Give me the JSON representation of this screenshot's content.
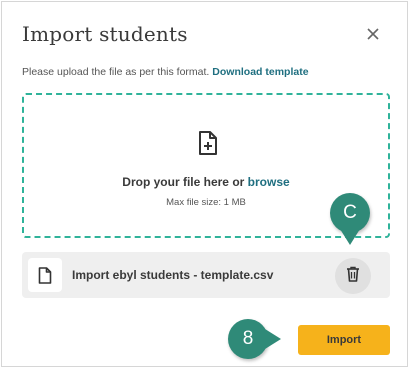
{
  "dialog": {
    "title": "Import students",
    "close_icon": "close-icon"
  },
  "instructions": {
    "text": "Please upload the file as per this format.",
    "link": "Download template"
  },
  "dropzone": {
    "icon": "file-add-icon",
    "prompt": "Drop your file here or",
    "browse": "browse",
    "max_size": "Max file size: 1 MB"
  },
  "file": {
    "icon": "file-icon",
    "name": "Import ebyl students - template.csv",
    "delete_icon": "trash-icon"
  },
  "actions": {
    "import_label": "Import"
  },
  "annotations": {
    "marker_c": "C",
    "marker_8": "8"
  },
  "colors": {
    "accent_teal": "#2fb39a",
    "link_blue": "#1f6f80",
    "import_yellow": "#f6b21b",
    "marker_green": "#2f8a78"
  }
}
